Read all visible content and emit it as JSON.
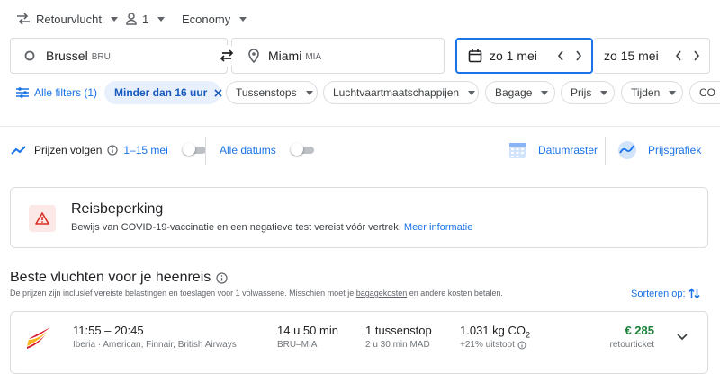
{
  "top_bar": {
    "trip_type": "Retourvlucht",
    "passengers": "1",
    "cabin_class": "Economy"
  },
  "search": {
    "origin": {
      "city": "Brussel",
      "code": "BRU"
    },
    "destination": {
      "city": "Miami",
      "code": "MIA"
    },
    "depart_date": "zo 1 mei",
    "return_date": "zo 15 mei"
  },
  "filters": {
    "all_filters": "Alle filters (1)",
    "active_chip": "Minder dan 16 uur",
    "chips": [
      "Tussenstops",
      "Luchtvaartmaatschappijen",
      "Bagage",
      "Prijs",
      "Tijden",
      "CO"
    ]
  },
  "tracking": {
    "track_label": "Prijzen volgen",
    "track_range": "1–15 mei",
    "all_dates_label": "Alle datums",
    "date_grid": "Datumraster",
    "price_graph": "Prijsgrafiek"
  },
  "alert": {
    "title": "Reisbeperking",
    "body": "Bewijs van COVID-19-vaccinatie en een negatieve test vereist vóór vertrek.",
    "link": "Meer informatie"
  },
  "results": {
    "title": "Beste vluchten voor je heenreis",
    "note_before": "De prijzen zijn inclusief vereiste belastingen en toeslagen voor 1 volwassene. Misschien moet je ",
    "note_link": "bagagekosten",
    "note_after": " en andere kosten betalen.",
    "sort_label": "Sorteren op:",
    "flights": [
      {
        "times": "11:55 – 20:45",
        "airlines": "Iberia · American, Finnair, British Airways",
        "duration": "14 u 50 min",
        "route": "BRU–MIA",
        "stops": "1 tussenstop",
        "stop_detail": "2 u 30 min MAD",
        "co2": "1.031 kg CO",
        "co2_sub": "2",
        "co2_delta": "+21% uitstoot",
        "price": "€ 285",
        "ticket_type": "retourticket"
      }
    ]
  },
  "colors": {
    "accent": "#1a73e8",
    "price_green": "#188038",
    "alert_red": "#d93025",
    "chip_active_bg": "#e8f0fe"
  }
}
